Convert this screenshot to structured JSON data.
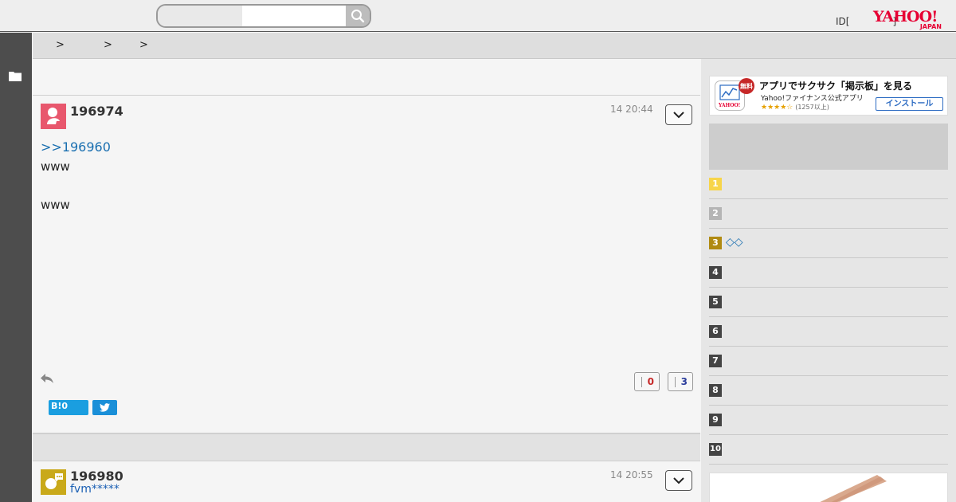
{
  "header": {
    "search_placeholder": "",
    "id_label": "ID[",
    "bracket_close": "]",
    "logo_main": "YAHOO!",
    "logo_sub": "JAPAN"
  },
  "breadcrumb": {
    "separators": [
      ">",
      ">",
      ">"
    ]
  },
  "posts": [
    {
      "number": "196974",
      "user": "",
      "time": "14 20:44",
      "reply_to": ">>196960",
      "body": [
        "www",
        "www"
      ],
      "votes_negative": "0",
      "votes_positive": "3",
      "hatena_label": "B!0"
    },
    {
      "number": "196980",
      "user": "fvm*****",
      "time": "14 20:55"
    }
  ],
  "sidebar": {
    "app_banner": {
      "title": "アプリでサクサク「掲示板」を見る",
      "subtitle": "Yahoo!ファイナンス公式アプリ",
      "stars": "★★★★☆",
      "reviews": "(1257以上)",
      "free_badge": "無料",
      "install_label": "インストール",
      "icon_text": "YAHOO!"
    },
    "ranking": [
      {
        "rank": "1",
        "text": "",
        "badge_color": "#f7d54a"
      },
      {
        "rank": "2",
        "text": "",
        "badge_color": "#b5b5b5"
      },
      {
        "rank": "3",
        "text": "◇◇",
        "badge_color": "#b08a12"
      },
      {
        "rank": "4",
        "text": "",
        "badge_color": "#444444"
      },
      {
        "rank": "5",
        "text": "",
        "badge_color": "#444444"
      },
      {
        "rank": "6",
        "text": "",
        "badge_color": "#444444"
      },
      {
        "rank": "7",
        "text": "",
        "badge_color": "#444444"
      },
      {
        "rank": "8",
        "text": "",
        "badge_color": "#444444"
      },
      {
        "rank": "9",
        "text": "",
        "badge_color": "#444444"
      },
      {
        "rank": "10",
        "text": "",
        "badge_color": "#444444"
      }
    ]
  },
  "icons": {
    "search": "search-icon",
    "folder": "folder-icon",
    "reply": "reply-icon",
    "chevron": "chevron-down-icon",
    "twitter": "twitter-icon"
  }
}
